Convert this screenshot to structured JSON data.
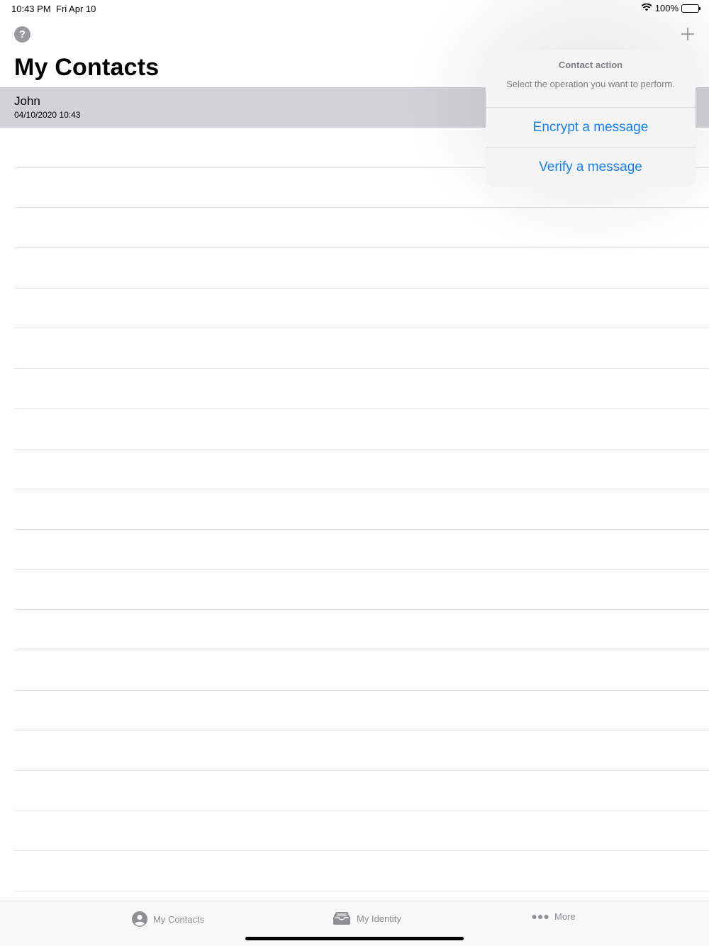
{
  "status_bar": {
    "time": "10:43 PM",
    "date": "Fri Apr 10",
    "battery": "100%"
  },
  "nav": {
    "title": "My Contacts",
    "help_icon": "question-circle-icon",
    "add_icon": "plus-icon"
  },
  "contacts": [
    {
      "name": "John",
      "date": "04/10/2020 10:43"
    }
  ],
  "popover": {
    "title": "Contact action",
    "message": "Select the operation you want to perform.",
    "actions": [
      "Encrypt a message",
      "Verify a message"
    ]
  },
  "tab_bar": {
    "items": [
      {
        "label": "My Contacts",
        "icon": "person-circle-icon"
      },
      {
        "label": "My Identity",
        "icon": "tray-icon"
      },
      {
        "label": "More",
        "icon": "ellipsis-icon"
      }
    ]
  },
  "colors": {
    "accent": "#147ef0",
    "selected_row": "#d1d1d6",
    "secondary_text": "#8e8e93"
  }
}
